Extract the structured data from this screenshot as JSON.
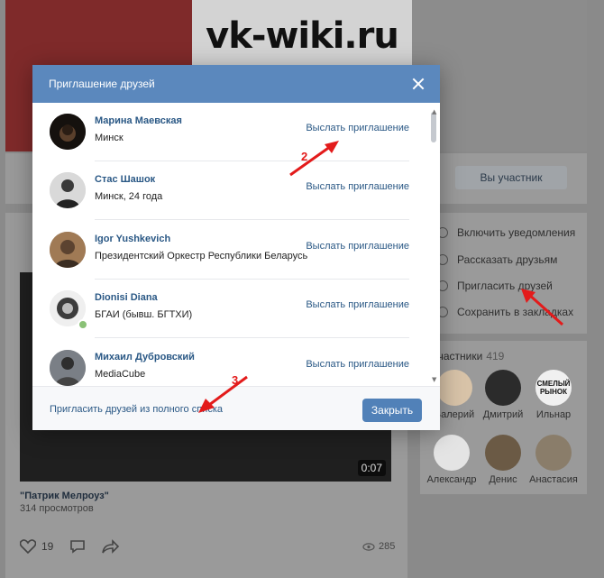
{
  "watermark": "vk-wiki.ru",
  "background": {
    "member_button": "Вы участник",
    "side_menu": [
      "Включить уведомления",
      "Рассказать друзьям",
      "Пригласить друзей",
      "Сохранить в закладках"
    ],
    "members_title": "Участники",
    "members_count": "419",
    "members": [
      {
        "name": "Валерий"
      },
      {
        "name": "Дмитрий"
      },
      {
        "name": "Ильнар"
      },
      {
        "name": "Александр"
      },
      {
        "name": "Денис"
      },
      {
        "name": "Анастасия"
      }
    ],
    "member_avatar_text": "СМЕЛЫЙ РЫНОК",
    "video_duration": "0:07",
    "post_title": "\"Патрик Мелроуз\"",
    "post_views": "314 просмотров",
    "likes": "19",
    "views_count": "285"
  },
  "modal": {
    "title": "Приглашение друзей",
    "invite_label": "Выслать приглашение",
    "friends": [
      {
        "name": "Марина Маевская",
        "sub": "Минск",
        "online": false
      },
      {
        "name": "Стас Шашок",
        "sub": "Минск, 24 года",
        "online": false
      },
      {
        "name": "Igor Yushkevich",
        "sub": "Президентский Оркестр Республики Беларусь",
        "online": false
      },
      {
        "name": "Dionisi Diana",
        "sub": "БГАИ (бывш. БГТХИ)",
        "online": true
      },
      {
        "name": "Михаил Дубровский",
        "sub": "MediaCube",
        "online": false
      }
    ],
    "footer_link": "Пригласить друзей из полного списка",
    "close_label": "Закрыть"
  },
  "annotations": {
    "arrow_color": "#e31b1b",
    "labels": [
      "2",
      "3"
    ]
  }
}
